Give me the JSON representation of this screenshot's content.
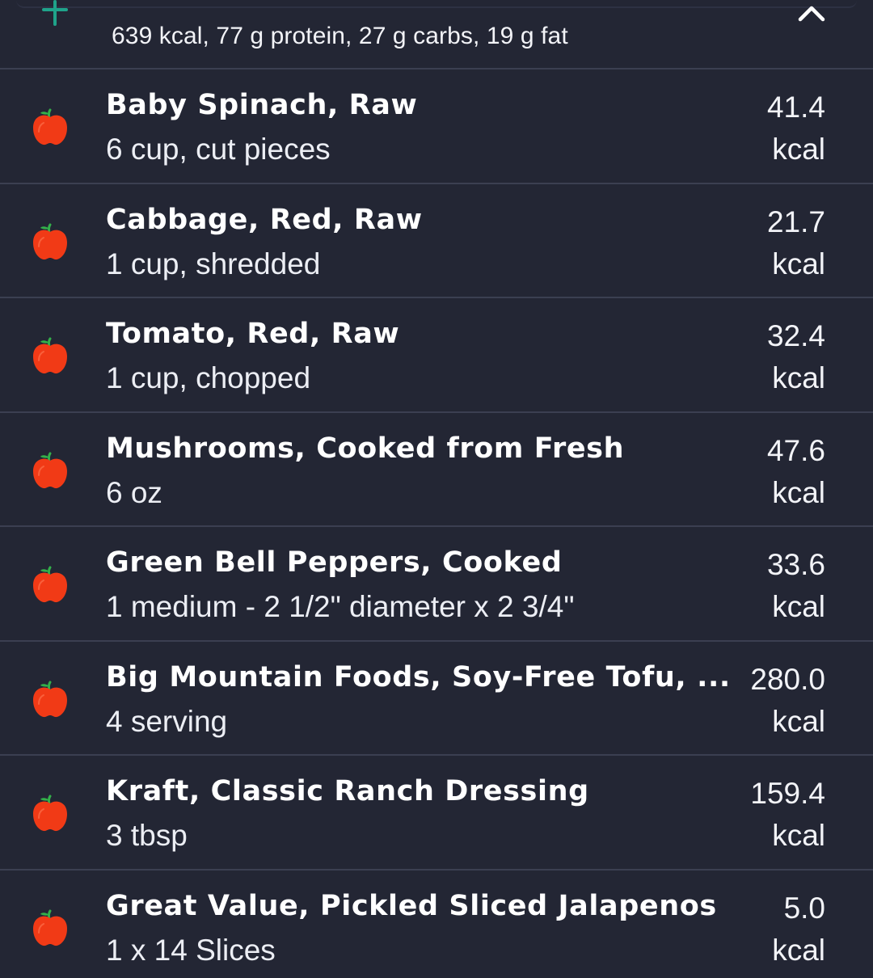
{
  "header": {
    "summary": "639 kcal, 77 g protein, 27 g carbs, 19 g fat",
    "add_icon": "plus-icon",
    "collapse_icon": "chevron-up-icon"
  },
  "colors": {
    "background": "#232634",
    "divider": "#3b3f51",
    "accent_green": "#1fa38a",
    "apple_red": "#f13a16",
    "leaf_green": "#33b04a"
  },
  "foods": [
    {
      "name": "Baby Spinach, Raw",
      "serving": "6 cup, cut pieces",
      "kcal": "41.4",
      "unit": "kcal",
      "icon": "apple-icon"
    },
    {
      "name": "Cabbage, Red, Raw",
      "serving": "1 cup, shredded",
      "kcal": "21.7",
      "unit": "kcal",
      "icon": "apple-icon"
    },
    {
      "name": "Tomato, Red, Raw",
      "serving": "1 cup, chopped",
      "kcal": "32.4",
      "unit": "kcal",
      "icon": "apple-icon"
    },
    {
      "name": "Mushrooms, Cooked from Fresh",
      "serving": "6 oz",
      "kcal": "47.6",
      "unit": "kcal",
      "icon": "apple-icon"
    },
    {
      "name": "Green Bell Peppers, Cooked",
      "serving": "1 medium - 2 1/2\" diameter x 2 3/4\"",
      "kcal": "33.6",
      "unit": "kcal",
      "icon": "apple-icon"
    },
    {
      "name": "Big Mountain Foods, Soy-Free Tofu, ...",
      "serving": "4 serving",
      "kcal": "280.0",
      "unit": "kcal",
      "icon": "apple-icon"
    },
    {
      "name": "Kraft, Classic Ranch Dressing",
      "serving": "3 tbsp",
      "kcal": "159.4",
      "unit": "kcal",
      "icon": "apple-icon"
    },
    {
      "name": "Great Value, Pickled Sliced Jalapenos",
      "serving": "1 x 14 Slices",
      "kcal": "5.0",
      "unit": "kcal",
      "icon": "apple-icon"
    }
  ]
}
